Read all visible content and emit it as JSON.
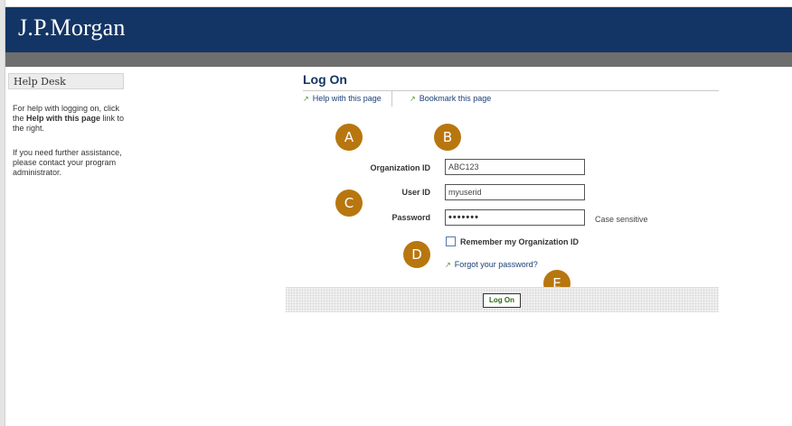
{
  "header": {
    "logo_text": "J.P.Morgan"
  },
  "sidebar": {
    "title": "Help Desk",
    "help_pre": "For help with logging on, click the ",
    "help_bold": "Help with this page",
    "help_post": " link to the right.",
    "assistance_text": "If you need further assistance, please contact your program administrator."
  },
  "main": {
    "title": "Log On",
    "links": {
      "help": "Help with this page",
      "bookmark": "Bookmark this page",
      "forgot": "Forgot your password?"
    },
    "fields": {
      "org_label": "Organization ID",
      "org_value": "ABC123",
      "user_label": "User ID",
      "user_value": "myuserid",
      "password_label": "Password",
      "password_mask": "•••••••",
      "case_note": "Case sensitive"
    },
    "remember_label": "Remember my Organization ID",
    "remember_checked": false,
    "logon_button": "Log On"
  },
  "markers": [
    "A",
    "B",
    "C",
    "D",
    "E"
  ],
  "colors": {
    "header_bg": "#133565",
    "grey_bar": "#6e6e6e",
    "marker": "#b8760f",
    "link_arrow": "#4a8a22",
    "title": "#133565"
  },
  "icons": {
    "link_arrow": "arrow-up-right-icon"
  }
}
